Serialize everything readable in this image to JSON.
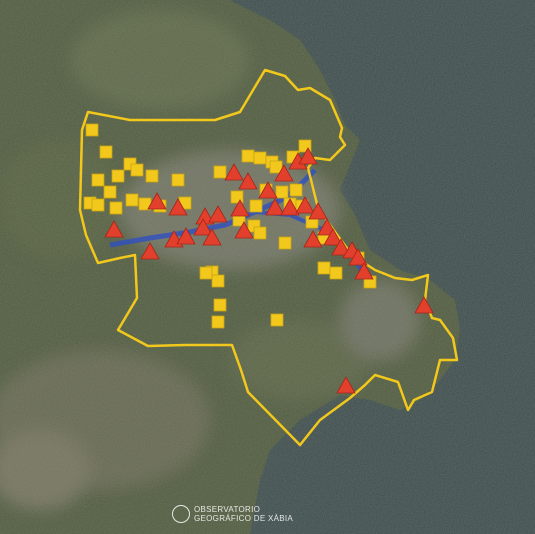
{
  "map": {
    "type": "satellite",
    "colors": {
      "boundary": "#f2c81c",
      "square_marker": "#f2c81c",
      "triangle_marker": "#e2402c",
      "river": "#3050c0"
    },
    "marker_types": [
      "square-marker",
      "triangle-marker"
    ]
  },
  "credit": {
    "line1": "OBSERVATORIO",
    "line2": "GEOGRÁFICO DE XÀBIA"
  }
}
